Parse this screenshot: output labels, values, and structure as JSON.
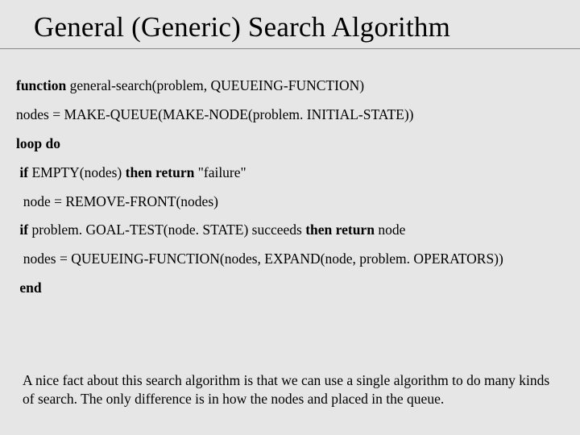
{
  "title": "General (Generic) Search Algorithm",
  "code": {
    "l1_kw": "function",
    "l1_rest": " general-search(problem, QUEUEING-FUNCTION)",
    "l2": "nodes = MAKE-QUEUE(MAKE-NODE(problem. INITIAL-STATE))",
    "l3": "loop do",
    "l4_pre": " ",
    "l4_kw1": "if",
    "l4_mid": " EMPTY(nodes) ",
    "l4_kw2": "then return",
    "l4_post": " \"failure\"",
    "l5": "  node = REMOVE-FRONT(nodes)",
    "l6_pre": " ",
    "l6_kw1": "if",
    "l6_mid": " problem. GOAL-TEST(node. STATE) succeeds ",
    "l6_kw2": "then return",
    "l6_post": " node",
    "l7": "  nodes = QUEUEING-FUNCTION(nodes, EXPAND(node, problem. OPERATORS))",
    "l8_pre": " ",
    "l8_kw": "end"
  },
  "footnote": "A nice fact about this search algorithm is that we can use a single algorithm to do many kinds of search. The only difference is in how the nodes and placed in the queue."
}
